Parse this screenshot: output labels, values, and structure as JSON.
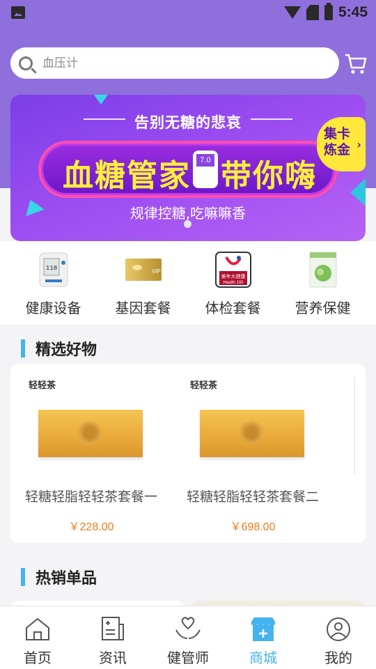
{
  "status_bar": {
    "time": "5:45"
  },
  "search": {
    "placeholder": "血压计"
  },
  "banner": {
    "top_text": "告别无糖的悲哀",
    "headline_left": "血糖管家",
    "headline_right": "带你嗨",
    "meter_value": "7.0",
    "sub_text": "规律控糖,吃嘛嘛香",
    "badge_line1": "集卡",
    "badge_line2": "炼金"
  },
  "categories": [
    {
      "label": "健康设备",
      "icon": "blood-pressure-monitor-icon"
    },
    {
      "label": "基因套餐",
      "icon": "vip-card-icon"
    },
    {
      "label": "体检套餐",
      "icon": "health100-logo-icon"
    },
    {
      "label": "营养保健",
      "icon": "nutrition-pack-icon"
    }
  ],
  "featured": {
    "title": "精选好物",
    "products": [
      {
        "name": "轻糖轻脂轻轻茶套餐一",
        "price": "￥228.00",
        "brand": "轻轻茶"
      },
      {
        "name": "轻糖轻脂轻轻茶套餐二",
        "price": "￥698.00",
        "brand": "轻轻茶"
      }
    ]
  },
  "hot": {
    "title": "热销单品"
  },
  "tabbar": {
    "items": [
      {
        "label": "首页",
        "icon": "home-icon"
      },
      {
        "label": "资讯",
        "icon": "news-icon"
      },
      {
        "label": "健管师",
        "icon": "health-manager-icon"
      },
      {
        "label": "商城",
        "icon": "shop-icon",
        "active": true
      },
      {
        "label": "我的",
        "icon": "profile-icon"
      }
    ]
  },
  "colors": {
    "header": "#8f6fdc",
    "accent": "#44b3ef",
    "price": "#f07b1c"
  }
}
